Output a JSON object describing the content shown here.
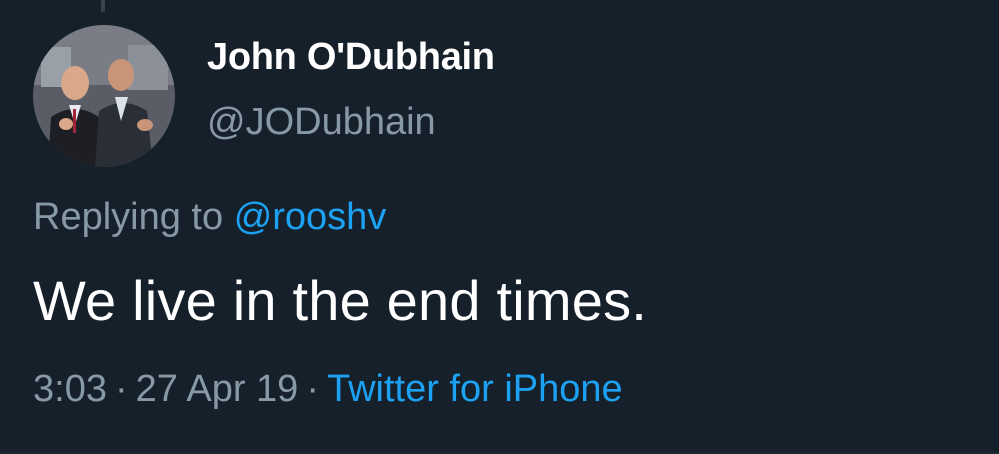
{
  "tweet": {
    "author": {
      "display_name": "John O'Dubhain",
      "handle": "@JODubhain"
    },
    "reply_prefix": "Replying to",
    "reply_to": "@rooshv",
    "text": "We live in the end times.",
    "time": "3:03",
    "date": "27 Apr 19",
    "source": "Twitter for iPhone",
    "separator": "·"
  },
  "colors": {
    "background": "#15202b",
    "primary_text": "#ffffff",
    "secondary_text": "#8899a6",
    "link": "#1da1f2"
  }
}
